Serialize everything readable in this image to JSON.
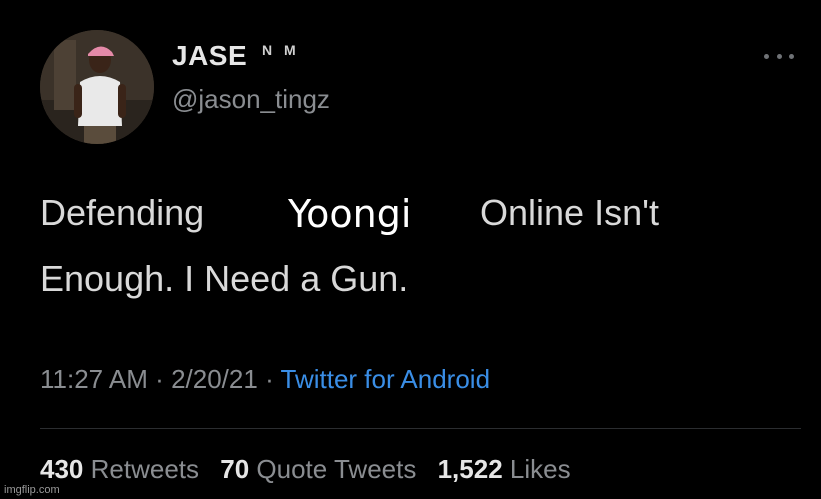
{
  "author": {
    "name": "JASE",
    "name_suffix": "N M",
    "handle": "@jason_tingz"
  },
  "tweet": {
    "line1_start": "Defending",
    "highlight_word": "Yoongi",
    "line1_end": "Online Isn't",
    "line2": "Enough. I Need a Gun."
  },
  "meta": {
    "time": "11:27 AM",
    "separator": "·",
    "date": "2/20/21",
    "source": "Twitter for Android"
  },
  "stats": {
    "retweets_count": "430",
    "retweets_label": "Retweets",
    "quotes_count": "70",
    "quotes_label": "Quote Tweets",
    "likes_count": "1,522",
    "likes_label": "Likes"
  },
  "watermark": "imgflip.com",
  "icons": {
    "more": "more-options-icon"
  },
  "colors": {
    "background": "#000000",
    "text": "#d9d9d9",
    "secondary": "#8a8d91",
    "link": "#3a8ee6"
  }
}
